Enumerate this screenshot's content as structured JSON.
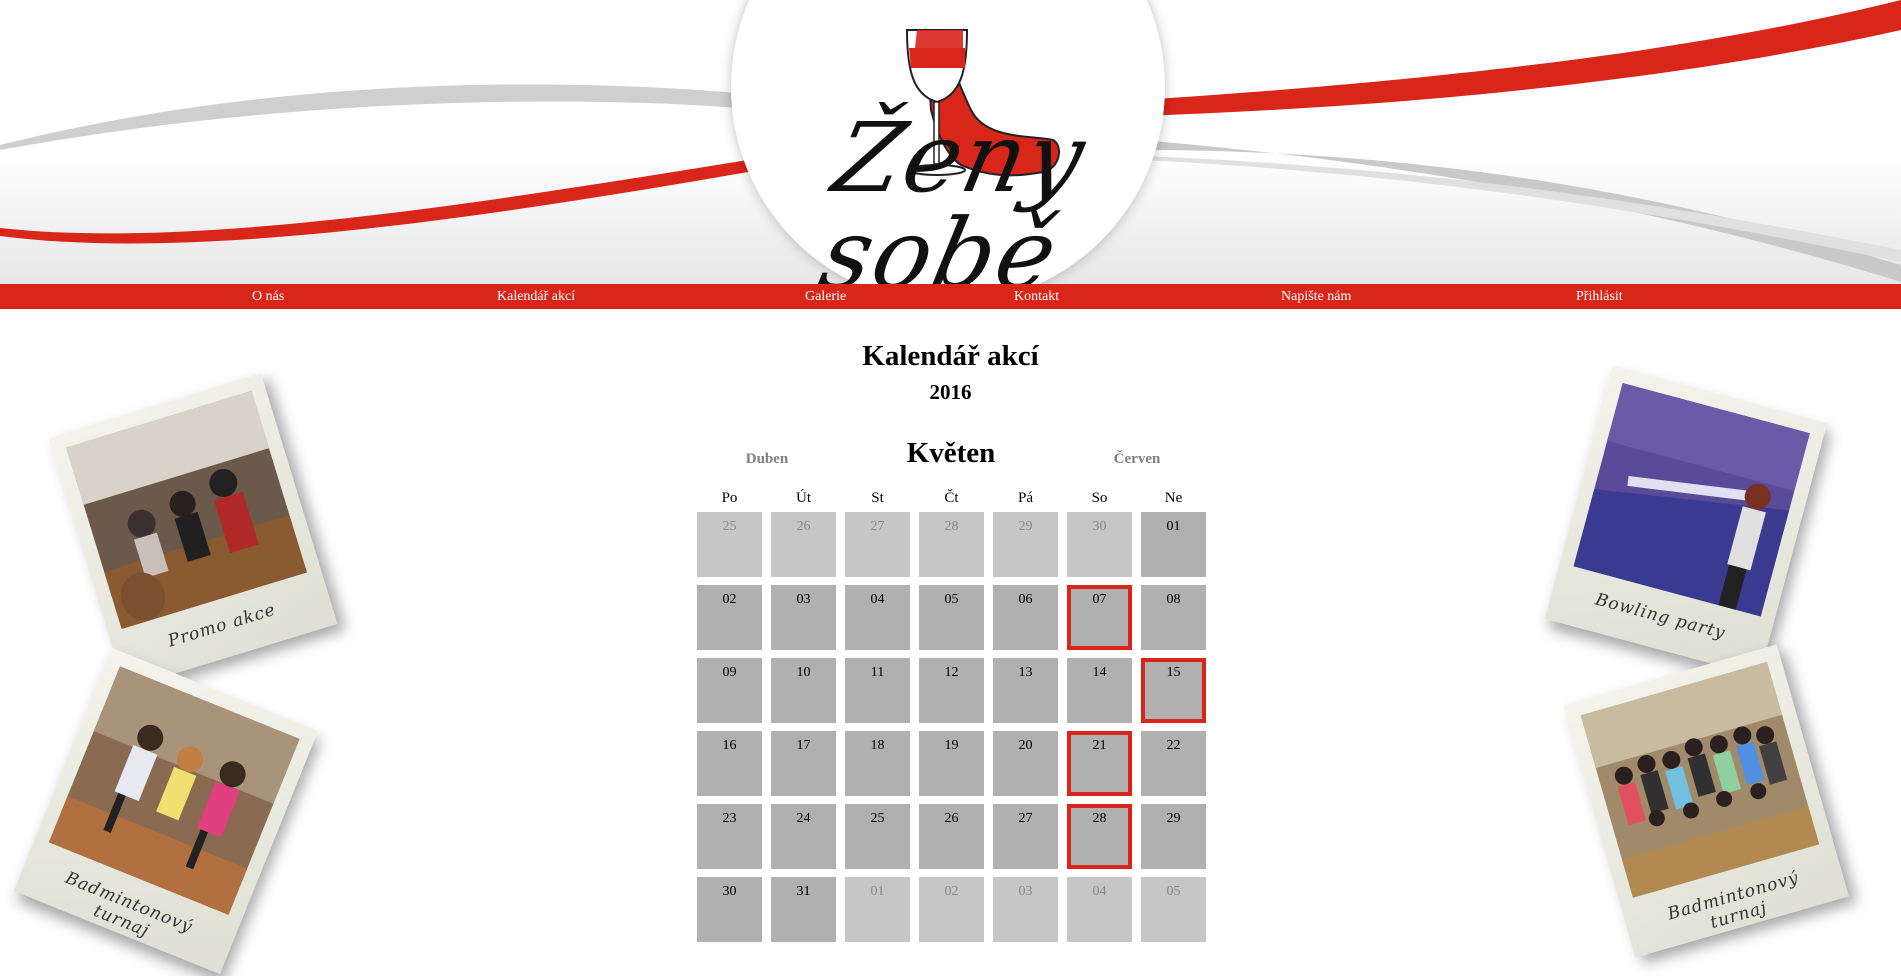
{
  "brand": {
    "logo_text": "Ženy sobě",
    "accent_color": "#d9261b"
  },
  "nav": {
    "items": [
      {
        "label": "O nás"
      },
      {
        "label": "Kalendář akcí"
      },
      {
        "label": "Galerie"
      },
      {
        "label": "Kontakt"
      },
      {
        "label": "Napište nám"
      },
      {
        "label": "Přihlásit"
      }
    ]
  },
  "calendar": {
    "title": "Kalendář akcí",
    "year": "2016",
    "current_month": "Květen",
    "prev_month": "Duben",
    "next_month": "Červen",
    "weekdays": [
      "Po",
      "Út",
      "St",
      "Čt",
      "Pá",
      "So",
      "Ne"
    ],
    "weeks": [
      [
        {
          "d": "25",
          "other": true
        },
        {
          "d": "26",
          "other": true
        },
        {
          "d": "27",
          "other": true
        },
        {
          "d": "28",
          "other": true
        },
        {
          "d": "29",
          "other": true
        },
        {
          "d": "30",
          "other": true
        },
        {
          "d": "01"
        }
      ],
      [
        {
          "d": "02"
        },
        {
          "d": "03"
        },
        {
          "d": "04"
        },
        {
          "d": "05"
        },
        {
          "d": "06"
        },
        {
          "d": "07",
          "event": true
        },
        {
          "d": "08"
        }
      ],
      [
        {
          "d": "09"
        },
        {
          "d": "10"
        },
        {
          "d": "11"
        },
        {
          "d": "12"
        },
        {
          "d": "13"
        },
        {
          "d": "14"
        },
        {
          "d": "15",
          "event": true
        }
      ],
      [
        {
          "d": "16"
        },
        {
          "d": "17"
        },
        {
          "d": "18"
        },
        {
          "d": "19"
        },
        {
          "d": "20"
        },
        {
          "d": "21",
          "event": true
        },
        {
          "d": "22"
        }
      ],
      [
        {
          "d": "23"
        },
        {
          "d": "24"
        },
        {
          "d": "25"
        },
        {
          "d": "26"
        },
        {
          "d": "27"
        },
        {
          "d": "28",
          "event": true
        },
        {
          "d": "29"
        }
      ],
      [
        {
          "d": "30"
        },
        {
          "d": "31"
        },
        {
          "d": "01",
          "other": true
        },
        {
          "d": "02",
          "other": true
        },
        {
          "d": "03",
          "other": true
        },
        {
          "d": "04",
          "other": true
        },
        {
          "d": "05",
          "other": true
        }
      ]
    ]
  },
  "photos": {
    "left": [
      {
        "caption": "Promo akce"
      },
      {
        "caption": "Badmintonový turnaj"
      }
    ],
    "right": [
      {
        "caption": "Bowling party"
      },
      {
        "caption": "Badmintonový turnaj"
      }
    ]
  }
}
